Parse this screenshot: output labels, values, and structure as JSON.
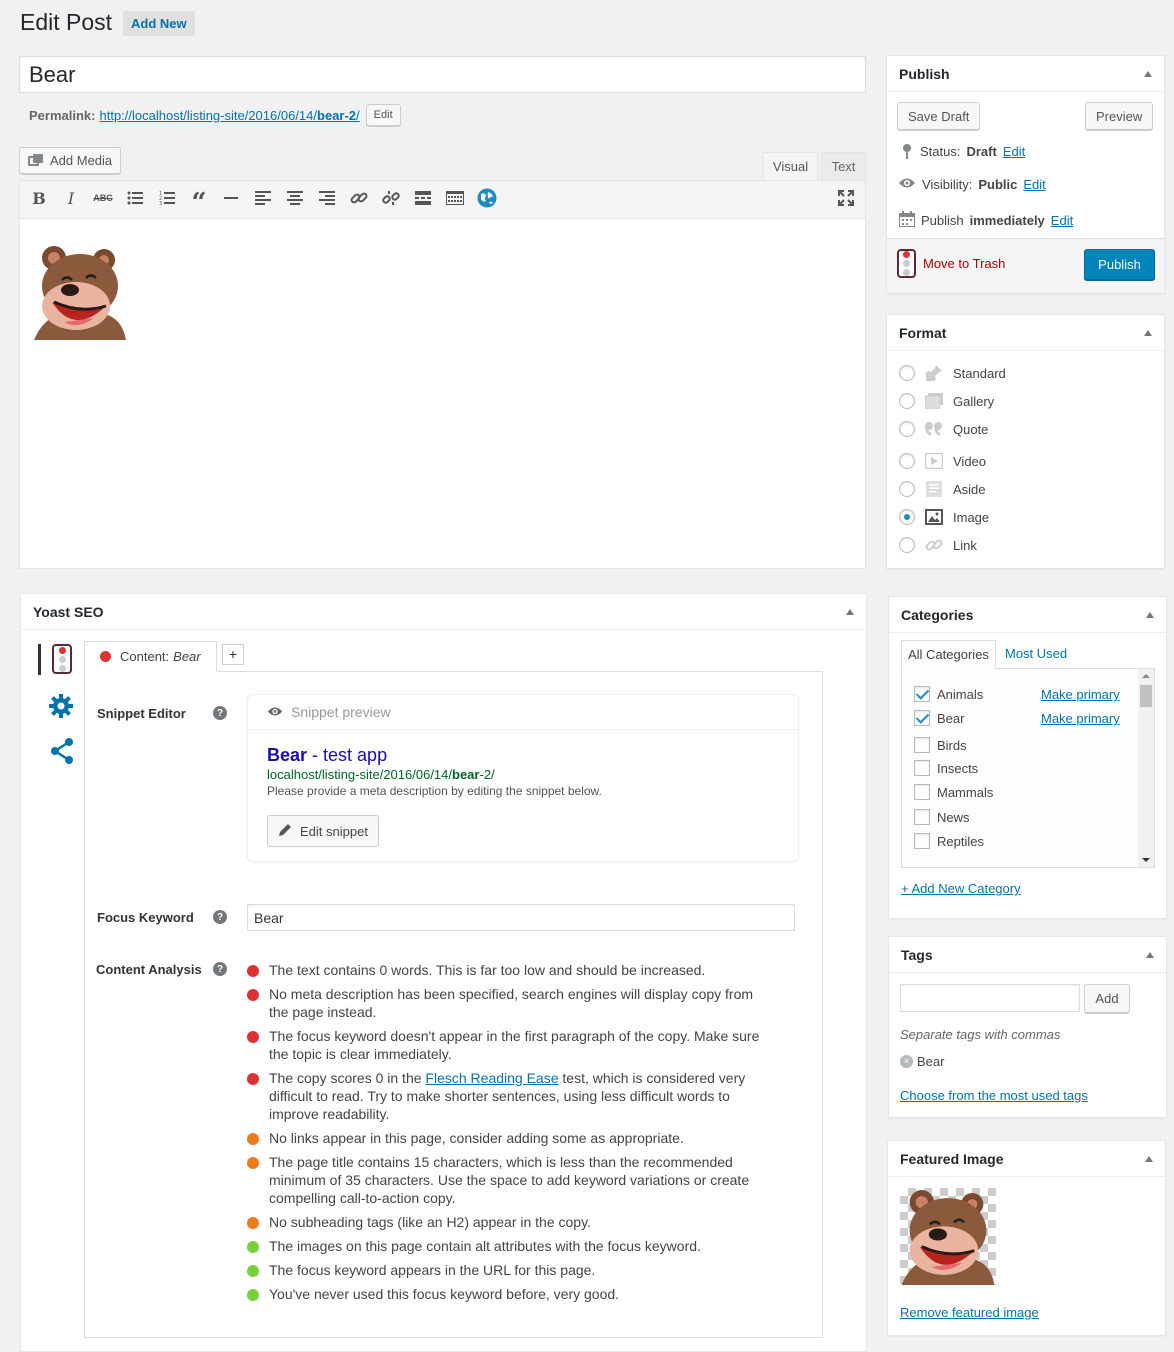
{
  "header": {
    "title": "Edit Post",
    "add_new": "Add New"
  },
  "post": {
    "title": "Bear",
    "permalink_label": "Permalink:",
    "permalink_base": "http://localhost/listing-site/2016/06/14/",
    "permalink_slug": "bear-2",
    "permalink_end": "/",
    "permalink_edit": "Edit"
  },
  "editor": {
    "add_media": "Add Media",
    "tab_visual": "Visual",
    "tab_text": "Text"
  },
  "publish": {
    "title": "Publish",
    "save_draft": "Save Draft",
    "preview": "Preview",
    "status_label": "Status:",
    "status_value": "Draft",
    "visibility_label": "Visibility:",
    "visibility_value": "Public",
    "schedule_label": "Publish",
    "schedule_value": "immediately",
    "edit": "Edit",
    "trash": "Move to Trash",
    "publish_button": "Publish"
  },
  "format": {
    "title": "Format",
    "options": [
      "Standard",
      "Gallery",
      "Quote",
      "Video",
      "Aside",
      "Image",
      "Link"
    ],
    "selected": "Image"
  },
  "categories": {
    "title": "Categories",
    "tab_all": "All Categories",
    "tab_most": "Most Used",
    "items": [
      {
        "label": "Animals",
        "checked": true
      },
      {
        "label": "Bear",
        "checked": true
      },
      {
        "label": "Birds",
        "checked": false
      },
      {
        "label": "Insects",
        "checked": false
      },
      {
        "label": "Mammals",
        "checked": false
      },
      {
        "label": "News",
        "checked": false
      },
      {
        "label": "Reptiles",
        "checked": false
      }
    ],
    "make_primary": "Make primary",
    "add_new": "+ Add New Category"
  },
  "tags": {
    "title": "Tags",
    "add": "Add",
    "hint": "Separate tags with commas",
    "tag": "Bear",
    "choose": "Choose from the most used tags"
  },
  "featured": {
    "title": "Featured Image",
    "remove": "Remove featured image"
  },
  "yoast": {
    "title": "Yoast SEO",
    "tab_label": "Content:",
    "tab_keyword": "Bear",
    "add_tab": "+",
    "snippet_editor": "Snippet Editor",
    "snippet_preview": "Snippet preview",
    "snippet_title_kw": "Bear",
    "snippet_title_rest": " - test app",
    "snippet_url_base": "localhost/listing-site/2016/06/14/",
    "snippet_url_kw": "bear",
    "snippet_url_end": "-2/",
    "snippet_desc": "Please provide a meta description by editing the snippet below.",
    "edit_snippet": "Edit snippet",
    "focus_label": "Focus Keyword",
    "focus_value": "Bear",
    "analysis_label": "Content Analysis",
    "analysis": [
      {
        "status": "red",
        "text": "The text contains 0 words. This is far too low and should be increased."
      },
      {
        "status": "red",
        "text": "No meta description has been specified, search engines will display copy from the page instead."
      },
      {
        "status": "red",
        "text": "The focus keyword doesn't appear in the first paragraph of the copy. Make sure the topic is clear immediately."
      },
      {
        "status": "red",
        "pre": "The copy scores 0 in the ",
        "link": "Flesch Reading Ease",
        "post": " test, which is considered very difficult to read. Try to make shorter sentences, using less difficult words to improve readability."
      },
      {
        "status": "orange",
        "text": "No links appear in this page, consider adding some as appropriate."
      },
      {
        "status": "orange",
        "text": "The page title contains 15 characters, which is less than the recommended minimum of 35 characters. Use the space to add keyword variations or create compelling call-to-action copy."
      },
      {
        "status": "orange",
        "text": "No subheading tags (like an H2) appear in the copy."
      },
      {
        "status": "green",
        "text": "The images on this page contain alt attributes with the focus keyword."
      },
      {
        "status": "green",
        "text": "The focus keyword appears in the URL for this page."
      },
      {
        "status": "green",
        "text": "You've never used this focus keyword before, very good."
      }
    ]
  },
  "colors": {
    "accent": "#0073aa",
    "publish": "#0085ba",
    "red": "#dc3232",
    "orange": "#ee7c1b",
    "green": "#7ad03a"
  }
}
